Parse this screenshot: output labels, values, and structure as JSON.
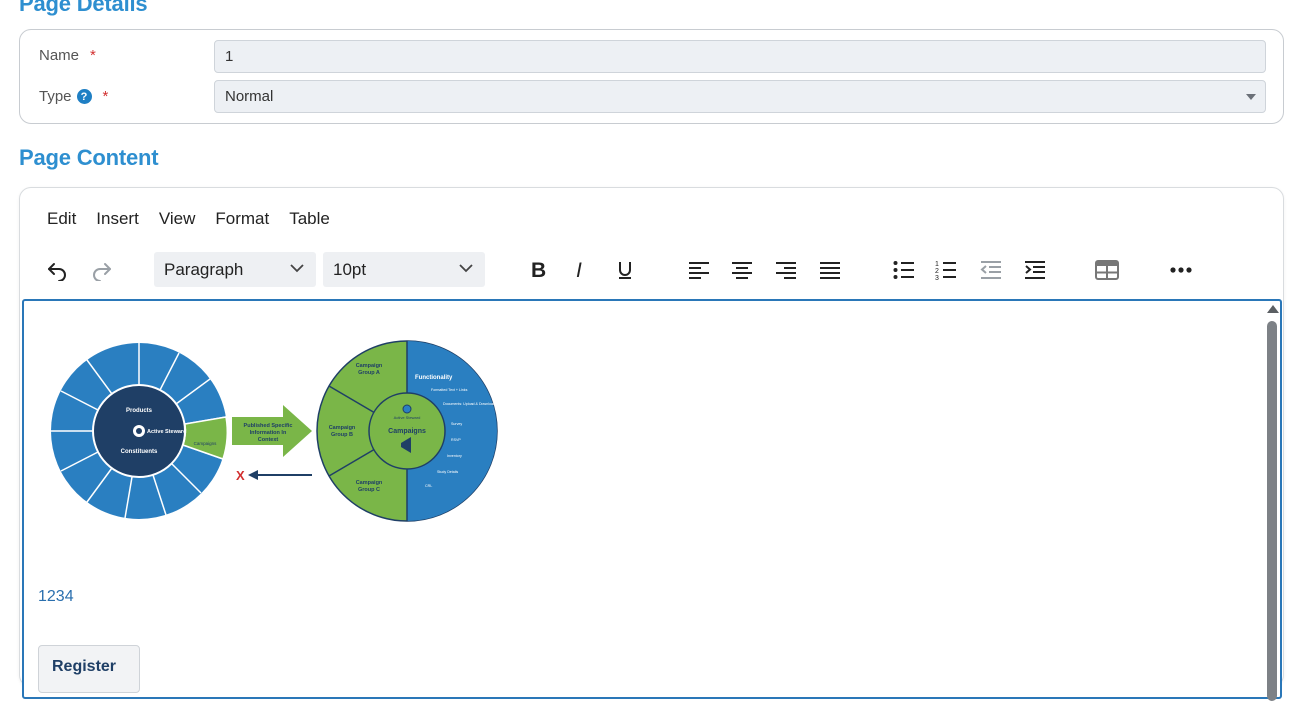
{
  "details": {
    "title": "Page Details",
    "name_label": "Name",
    "name_value": "1",
    "type_label": "Type",
    "type_value": "Normal",
    "required_mark": "*",
    "help_glyph": "?"
  },
  "content": {
    "title": "Page Content",
    "menu": [
      "Edit",
      "Insert",
      "View",
      "Format",
      "Table"
    ],
    "block_format": "Paragraph",
    "font_size": "10pt",
    "link_text": "1234",
    "button_label": "Register",
    "diagram": {
      "left_wheel": {
        "center_top": "Products",
        "center_mid": "Active Steward",
        "center_bottom": "Constituents",
        "highlight": "Campaigns"
      },
      "arrow_text": [
        "Published Specific",
        "Information In",
        "Context"
      ],
      "x_mark": "X",
      "right_wheel": {
        "group_a": [
          "Campaign",
          "Group A"
        ],
        "group_b": [
          "Campaign",
          "Group B"
        ],
        "group_c": [
          "Campaign",
          "Group C"
        ],
        "center": "Campaigns",
        "center_brand": "Active Steward",
        "functionality_title": "Functionality",
        "functionality_items": [
          "Formatted Text + Links",
          "Documents: Upload & Download",
          "Survey",
          "RSVP",
          "Inventory",
          "Study Details",
          "CRL"
        ]
      }
    }
  },
  "colors": {
    "accent": "#2e8fd0",
    "dark_navy": "#1f3f66",
    "wheel_blue": "#2a7fc1",
    "wheel_green": "#7ab648"
  }
}
